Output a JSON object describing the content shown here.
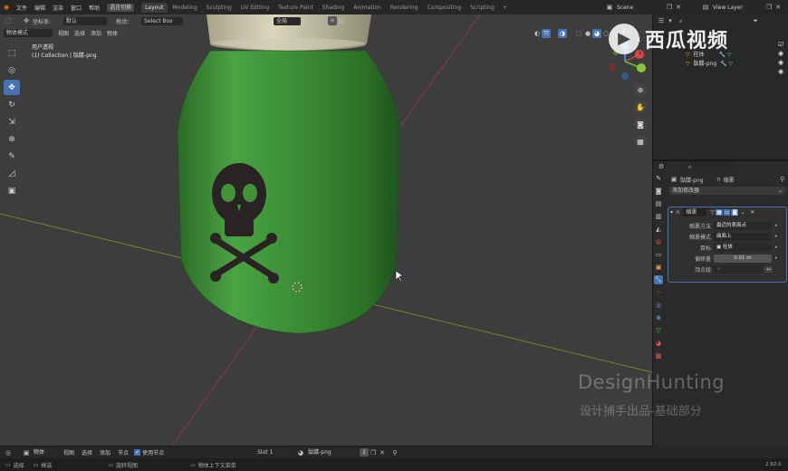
{
  "topbar": {
    "menu": [
      "文件",
      "编辑",
      "渲染",
      "窗口",
      "帮助"
    ],
    "lang_button": "语言切换",
    "workspaces": [
      "Layout",
      "Modeling",
      "Sculpting",
      "UV Editing",
      "Texture Paint",
      "Shading",
      "Animation",
      "Rendering",
      "Compositing",
      "Scripting"
    ],
    "active_workspace": "Layout",
    "add_tab": "+",
    "scene": "Scene",
    "view_layer": "View Layer"
  },
  "viewport_header": {
    "coord_label": "坐标系:",
    "coord_value": "默认",
    "drag_label": "拖动：",
    "drag_value": "Select Box",
    "pivot_value": "全局",
    "mode": "物体模式",
    "menus": [
      "视图",
      "选择",
      "添加",
      "物体"
    ]
  },
  "viewport": {
    "view_name": "用户透视",
    "collection_info": "(1) Collection | 骷髅-png",
    "gizmo_axes": [
      "X",
      "Y",
      "Z"
    ]
  },
  "outliner": {
    "items": [
      {
        "label": "柱体"
      },
      {
        "label": "骷髅-png"
      }
    ]
  },
  "properties": {
    "object_name": "骷髅-png",
    "modifier_tab_label": "缩裹",
    "add_modifier": "添加修改器",
    "modifier_name": "缩裹",
    "rows": [
      {
        "label": "缩裹方法",
        "value": "最近的表面点"
      },
      {
        "label": "缩裹模式",
        "value": "曲面上"
      },
      {
        "label": "目标",
        "value": "柱体"
      },
      {
        "label": "偏移量",
        "value": "0.01 m"
      },
      {
        "label": "顶点组",
        "value": ""
      }
    ]
  },
  "timeline": {
    "mode": "物体",
    "menus": [
      "视图",
      "选择",
      "添加",
      "节点"
    ],
    "use_nodes": "使用节点",
    "slot": "Slot 1",
    "material": "骷髅-png",
    "user_count": "2"
  },
  "statusbar": {
    "items": [
      "选择",
      "框选",
      "旋转视图",
      "物体上下文菜单"
    ],
    "version": "2.92.0"
  },
  "watermark": {
    "brand": "西瓜视频",
    "design_hunting": "DesignHunting",
    "subtitle": "设计捕手出品-基础部分"
  },
  "colors": {
    "accent": "#4772b3",
    "viewport_bg": "#3d3d3d",
    "bottle_green": "#3f9a3a"
  }
}
